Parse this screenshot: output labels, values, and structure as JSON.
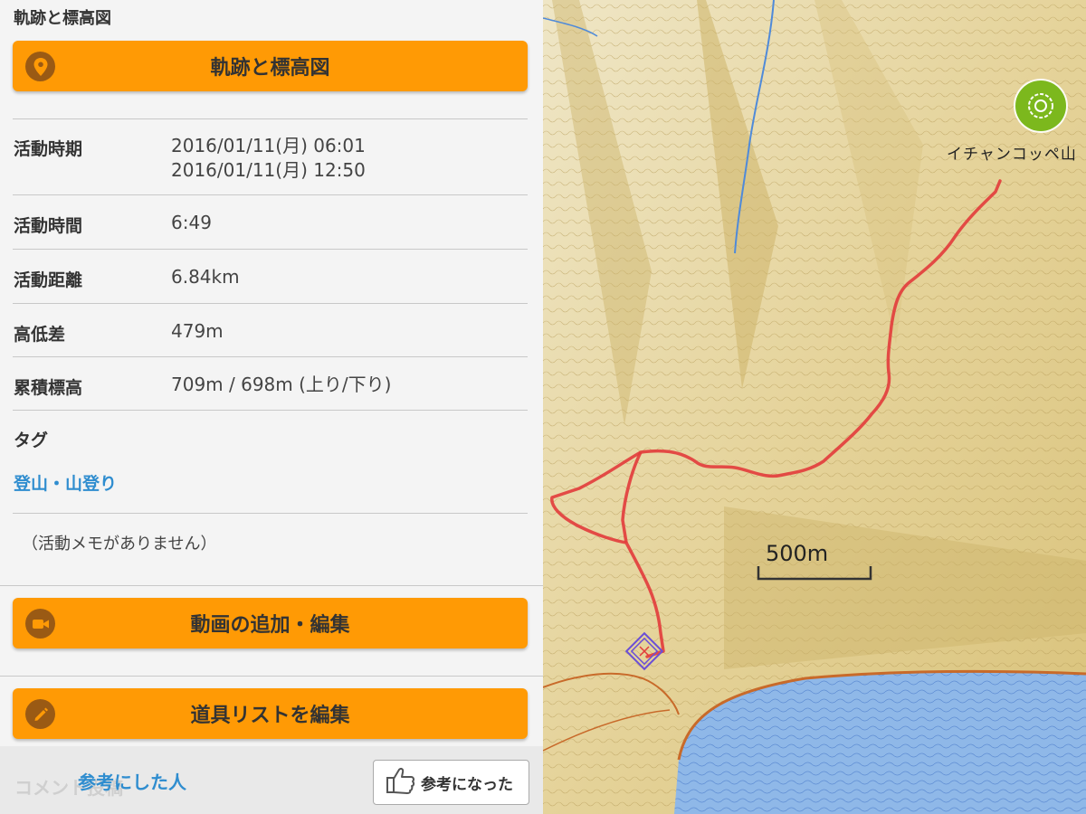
{
  "header": {
    "section_title": "軌跡と標高図"
  },
  "buttons": {
    "track": {
      "label": "軌跡と標高図",
      "icon": "map-pin-icon"
    },
    "video": {
      "label": "動画の追加・編集",
      "icon": "video-camera-icon"
    },
    "gear": {
      "label": "道具リストを編集",
      "icon": "pencil-icon"
    }
  },
  "details": [
    {
      "key": "活動時期",
      "value": "2016/01/11(月) 06:01",
      "value2": "2016/01/11(月) 12:50"
    },
    {
      "key": "活動時間",
      "value": "6:49"
    },
    {
      "key": "活動距離",
      "value": "6.84km"
    },
    {
      "key": "高低差",
      "value": "479m"
    },
    {
      "key": "累積標高",
      "value": "709m / 698m (上り/下り)"
    }
  ],
  "tags": {
    "heading": "タグ",
    "items": [
      "登山・山登り"
    ]
  },
  "memo": "（活動メモがありません）",
  "footer": {
    "ghost_text": "コメント投稿",
    "referrers_link": "参考にした人",
    "helpful_button": {
      "label": "参考になった",
      "icon": "thumbs-up-icon"
    }
  },
  "map": {
    "peak_name": "イチャンコッペ山",
    "scale_label": "500m",
    "colors": {
      "track": "#e23b3b",
      "lake": "#8fb8e8",
      "terrain": "#e8d9a4",
      "accent": "#ff9a05",
      "link": "#2f8dcf"
    }
  }
}
